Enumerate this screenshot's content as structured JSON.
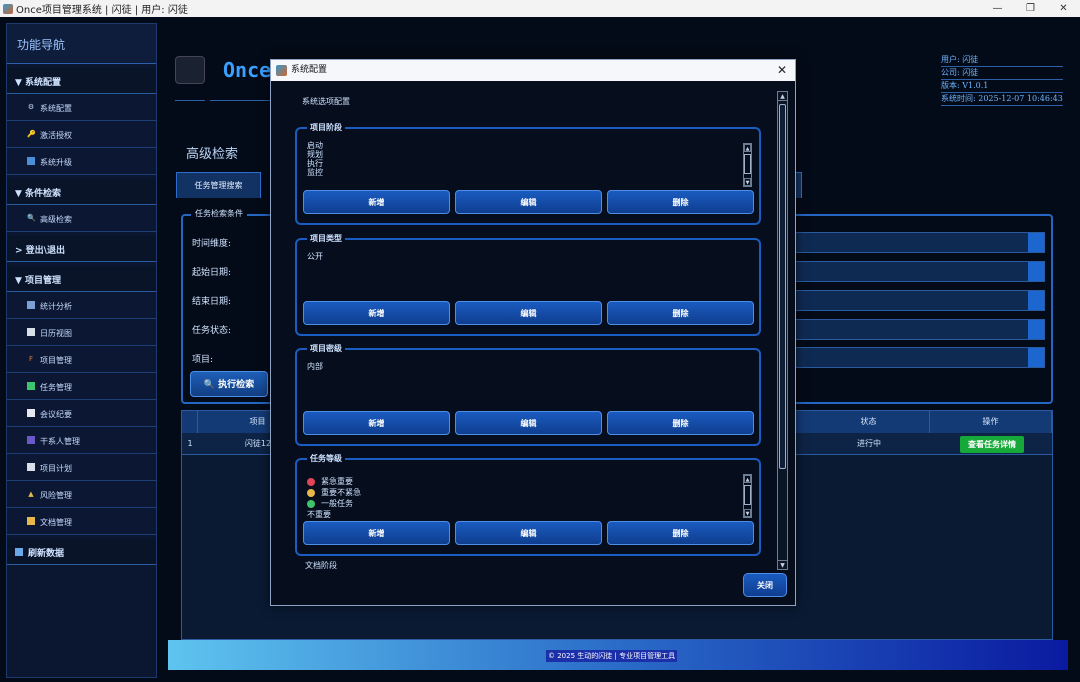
{
  "window": {
    "title": "Once项目管理系统 | 闪徒 | 用户: 闪徒"
  },
  "sidebar": {
    "title": "功能导航",
    "groups": [
      {
        "label": "▼ 系统配置",
        "items": [
          "系统配置",
          "激活授权",
          "系统升级"
        ]
      },
      {
        "label": "▼ 条件检索",
        "items": [
          "高级检索"
        ]
      },
      {
        "label": "> 登出\\退出",
        "items": []
      },
      {
        "label": "▼ 项目管理",
        "items": [
          "统计分析",
          "日历视图",
          "项目管理",
          "任务管理",
          "会议纪要",
          "干系人管理",
          "项目计划",
          "风险管理",
          "文档管理"
        ]
      }
    ],
    "refresh": "刷新数据"
  },
  "header": {
    "logo_text": "Once",
    "user": "用户: 闪徒",
    "company": "公司: 闪徒",
    "version": "版本: V1.0.1",
    "time": "系统时间: 2025-12-07 10:46:43"
  },
  "main": {
    "section_title": "高级检索",
    "tab_label": "任务管理搜索",
    "search_legend": "任务检索条件",
    "labels": [
      "时间维度:",
      "起始日期:",
      "结束日期:",
      "任务状态:",
      "项目:"
    ],
    "exec_button": "执行检索",
    "table": {
      "headers": [
        "项目",
        "状态",
        "操作"
      ],
      "row": {
        "index": "1",
        "project": "闪徒12",
        "status": "进行中",
        "action": "查看任务详情"
      }
    }
  },
  "footer": {
    "text": "© 2025 生动的闪徒 | 专业项目管理工具"
  },
  "dialog": {
    "title": "系统配置",
    "outer_legend": "系统选项配置",
    "groups": [
      {
        "legend": "项目阶段",
        "items": [
          "启动",
          "规划",
          "执行",
          "监控"
        ]
      },
      {
        "legend": "项目类型",
        "items": [
          "公开"
        ]
      },
      {
        "legend": "项目密级",
        "items": [
          "内部"
        ]
      },
      {
        "legend": "任务等级",
        "items": [
          "紧急重要",
          "重要不紧急",
          "一般任务",
          "不重要"
        ]
      }
    ],
    "buttons": {
      "add": "新增",
      "edit": "编辑",
      "delete": "删除"
    },
    "next_legend": "文档阶段",
    "close": "关闭",
    "colors": {
      "red": "#e0455a",
      "yellow": "#e6b84a",
      "green": "#3ec46d"
    }
  }
}
